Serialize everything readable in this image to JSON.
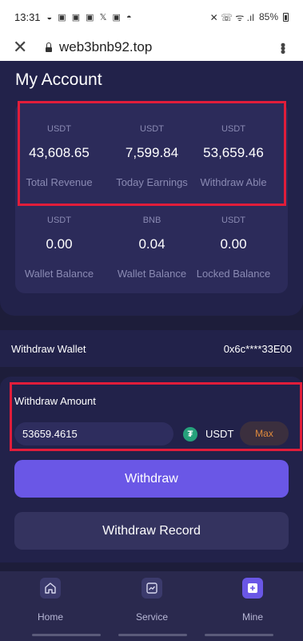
{
  "status_bar": {
    "time": "13:31",
    "notif_icons": "◒ ▣ ▣ ▣ 𝕏 ▣ ◓",
    "right_icons": "✕ ☏ ᯤ .ıl",
    "battery": "85%"
  },
  "browser": {
    "url": "web3bnb92.top",
    "close_glyph": "✕",
    "menu_glyph": "•••"
  },
  "account": {
    "title": "My Account",
    "stats": [
      {
        "unit": "USDT",
        "value": "43,608.65",
        "label": "Total Revenue"
      },
      {
        "unit": "USDT",
        "value": "7,599.84",
        "label": "Today Earnings"
      },
      {
        "unit": "USDT",
        "value": "53,659.46",
        "label": "Withdraw Able"
      },
      {
        "unit": "USDT",
        "value": "0.00",
        "label": "Wallet Balance"
      },
      {
        "unit": "BNB",
        "value": "0.04",
        "label": "Wallet Balance"
      },
      {
        "unit": "USDT",
        "value": "0.00",
        "label": "Locked Balance"
      }
    ]
  },
  "wallet": {
    "label": "Withdraw Wallet",
    "address": "0x6c****33E00"
  },
  "withdraw": {
    "amount_label": "Withdraw Amount",
    "amount_value": "53659.4615",
    "currency": "USDT",
    "currency_glyph": "₮",
    "max_label": "Max",
    "withdraw_label": "Withdraw",
    "record_label": "Withdraw Record"
  },
  "nav": {
    "items": [
      {
        "label": "Home",
        "icon": "home-icon"
      },
      {
        "label": "Service",
        "icon": "service-icon"
      },
      {
        "label": "Mine",
        "icon": "mine-icon"
      }
    ],
    "active": "Mine"
  },
  "colors": {
    "background": "#1d1d3a",
    "card": "#2c2b5a",
    "accent": "#6a57e6",
    "highlight": "#e11d3a",
    "max_text": "#e08a3c",
    "tether": "#26a17b"
  }
}
